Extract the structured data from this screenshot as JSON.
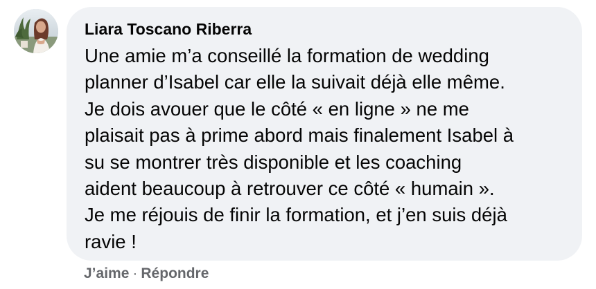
{
  "comment": {
    "author": "Liara Toscano Riberra",
    "lines": [
      "Une amie m’a conseillé la formation de wedding",
      "planner d’Isabel car elle la suivait déjà elle même.",
      "Je dois avouer que le côté « en ligne » ne me",
      "plaisait pas à prime abord mais finalement Isabel à",
      "su se montrer très disponible et les coaching",
      "aident beaucoup à retrouver ce côté « humain ».",
      "Je me réjouis de finir la formation, et j’en suis déjà",
      "ravie !"
    ],
    "actions": {
      "like": "J’aime",
      "separator": "·",
      "reply": "Répondre"
    }
  },
  "colors": {
    "bubble_background": "#f0f2f5",
    "text": "#050505",
    "action_text": "#65676b"
  },
  "icons": {
    "avatar": "profile-photo"
  }
}
